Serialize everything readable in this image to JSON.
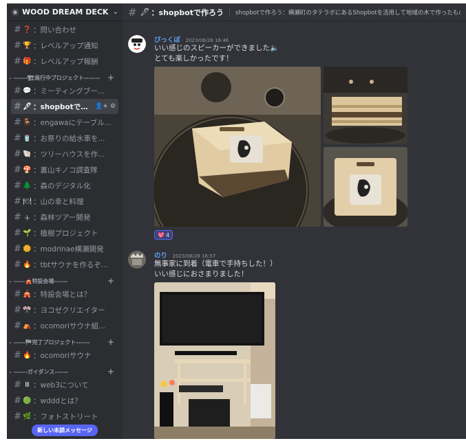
{
  "server": {
    "name": "WOOD DREAM DECK",
    "icon": "wood-icon"
  },
  "sidebar": {
    "items": [
      {
        "type": "channel",
        "emoji": "❓",
        "label": "：問い合わせ",
        "color": "#ed4245"
      },
      {
        "type": "channel",
        "emoji": "🏆",
        "label": "：レベルアップ通知",
        "color": "#f0b232"
      },
      {
        "type": "channel",
        "emoji": "🎁",
        "label": "：レベルアップ報酬",
        "color": "#f0b232"
      },
      {
        "type": "category",
        "label": "------🏗進行中プロジェクト-------"
      },
      {
        "type": "channel",
        "emoji": "💬",
        "label": "：ミーティングブー...",
        "color": "#dbdee1"
      },
      {
        "type": "channel",
        "emoji": "🖋",
        "label": "：shopbotで作...",
        "color": "#f2f3f5",
        "active": true,
        "actions": "👤+ ⚙"
      },
      {
        "type": "channel",
        "emoji": "🪑",
        "label": "：engawaにテーブル...",
        "color": "#dbdee1"
      },
      {
        "type": "channel",
        "emoji": "🥤",
        "label": "：お祭りの給水車を...",
        "color": "#dbdee1"
      },
      {
        "type": "channel",
        "emoji": "🐚",
        "label": "：ツリーハウスを作...",
        "color": "#d6a65a"
      },
      {
        "type": "channel",
        "emoji": "🍄",
        "label": "：裏山キノコ調査隊",
        "color": "#ed4245"
      },
      {
        "type": "channel",
        "emoji": "🌲",
        "label": "：森のデジタル化",
        "color": "#3ba55d"
      },
      {
        "type": "channel",
        "emoji": "🍽",
        "label": "：山の幸と料理",
        "color": "#dbdee1"
      },
      {
        "type": "channel",
        "emoji": "＋",
        "label": "：森林ツアー開発",
        "color": "#dbdee1"
      },
      {
        "type": "channel",
        "emoji": "🌱",
        "label": "：植樹プロジェクト",
        "color": "#3ba55d"
      },
      {
        "type": "channel",
        "emoji": "🌼",
        "label": "：modrinae横瀬開発",
        "color": "#f0b232"
      },
      {
        "type": "channel",
        "emoji": "🔥",
        "label": "：tbtサウナを作るぞ...",
        "color": "#f57731"
      },
      {
        "type": "category",
        "label": "-----🎪特設会場------"
      },
      {
        "type": "channel",
        "emoji": "🎪",
        "label": "：特設会場とは？",
        "color": "#dbdee1"
      },
      {
        "type": "channel",
        "emoji": "🎌",
        "label": "：ヨコゼクリエイター",
        "color": "#dbdee1"
      },
      {
        "type": "channel",
        "emoji": "⛺",
        "label": "：ocomoriサウナ組...",
        "color": "#dbdee1"
      },
      {
        "type": "category",
        "label": "-----🏁完了プロジェクト------"
      },
      {
        "type": "channel",
        "emoji": "🔥",
        "label": "：ocomoriサウナ",
        "color": "#f57731"
      },
      {
        "type": "category",
        "label": "------ガイダンス------"
      },
      {
        "type": "channel",
        "emoji": "Ⅲ",
        "label": "：web3について",
        "color": "#dbdee1"
      },
      {
        "type": "channel",
        "emoji": "🟢",
        "label": "：wdddとは？",
        "color": "#3ba55d"
      },
      {
        "type": "channel",
        "emoji": "🌿",
        "label": "：フォトストリート",
        "color": "#3ba55d"
      }
    ],
    "new_messages_label": "新しい未読メッセージ"
  },
  "channel": {
    "emoji": "🖋",
    "title": "：shopbotで作ろう",
    "topic": "shopbotで作ろう：横瀬町のタテラボにあるShopbotを活用して地域の木で作ったものを"
  },
  "messages": [
    {
      "author": "びっくぼ",
      "author_color": "#5ea2f0",
      "timestamp": "2023/06/28 16:46",
      "lines": [
        "いい感じのスピーカーができました🔈",
        "とても楽しかったです！"
      ],
      "reaction": {
        "emoji": "💖",
        "count": "4"
      }
    },
    {
      "author": "のり",
      "author_color": "#5ea2f0",
      "timestamp": "2023/06/28 16:57",
      "lines": [
        "無事家に到着（電車で手持ちした！）",
        "いい感じにおさまりました！"
      ]
    }
  ]
}
